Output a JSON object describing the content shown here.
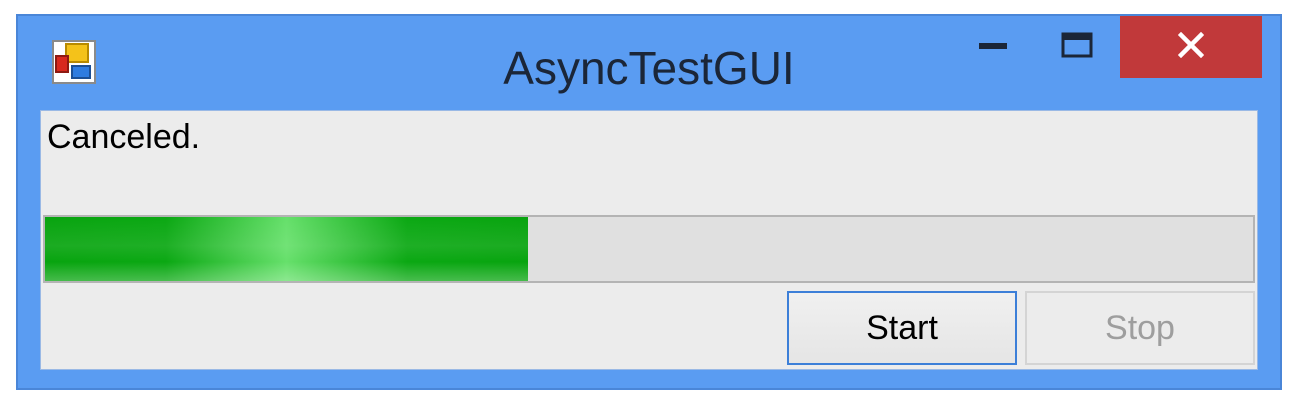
{
  "window": {
    "title": "AsyncTestGUI",
    "icon": "app-icon",
    "controls": {
      "minimize_icon": "minimize-icon",
      "maximize_icon": "maximize-icon",
      "close_icon": "close-icon",
      "close_color": "#c1393a"
    },
    "frame_color": "#5a9cf2"
  },
  "status": {
    "text": "Canceled."
  },
  "progress": {
    "value_percent": 40,
    "fill_color": "#08a40f"
  },
  "buttons": {
    "start_label": "Start",
    "stop_label": "Stop",
    "stop_enabled": false
  }
}
